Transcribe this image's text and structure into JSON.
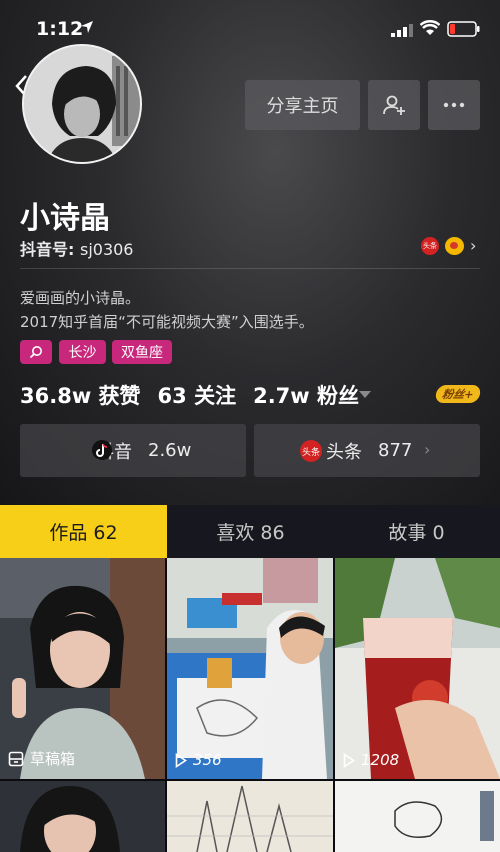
{
  "status_bar": {
    "time": "1:12"
  },
  "header": {
    "share_button": "分享主页",
    "name": "小诗晶",
    "id_label": "抖音号: ",
    "id_value": "sj0306",
    "toutiao_small": "头条",
    "bio_line1": "爱画画的小诗晶。",
    "bio_line2": "2017知乎首届“不可能视频大赛”入围选手。",
    "tags": [
      "长沙",
      "双鱼座"
    ]
  },
  "stats": {
    "likes": "36.8w 获赞",
    "following": "63 关注",
    "fans": "2.7w 粉丝",
    "fans_badge": "粉丝+"
  },
  "platforms": {
    "douyin_label": "抖音",
    "douyin_value": "2.6w",
    "toutiao_badge": "头条",
    "toutiao_label": "头条",
    "toutiao_value": "877"
  },
  "tabs": [
    {
      "label": "作品 62",
      "active": true
    },
    {
      "label": "喜欢 86",
      "active": false
    },
    {
      "label": "故事 0",
      "active": false
    }
  ],
  "grid": {
    "draft_label": "草稿箱",
    "play_counts": [
      "356",
      "1208"
    ]
  },
  "colors": {
    "accent_yellow": "#f7cf19",
    "tag_pink": "#c8287c",
    "toutiao_red": "#d22222"
  }
}
